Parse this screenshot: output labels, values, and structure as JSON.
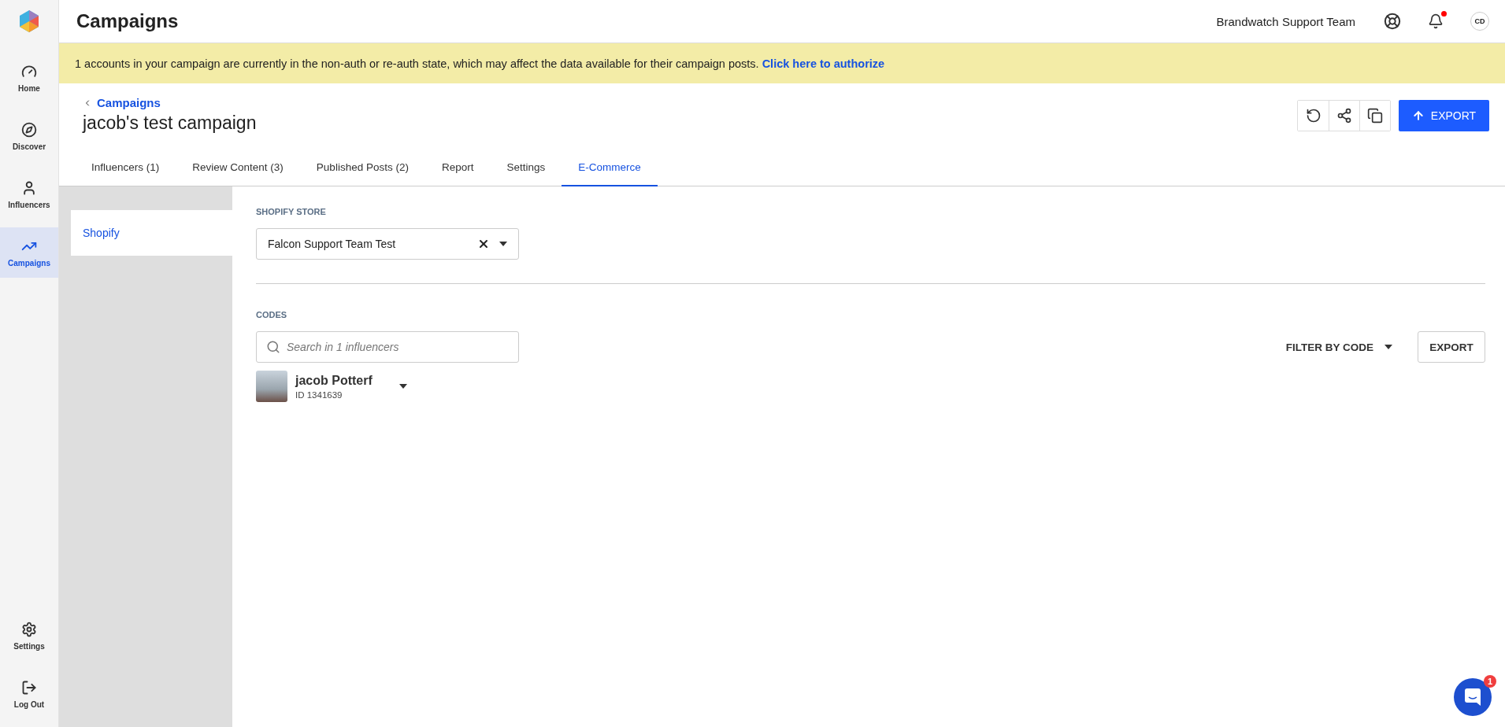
{
  "nav": {
    "items": [
      {
        "label": "Home",
        "selected": false
      },
      {
        "label": "Discover",
        "selected": false
      },
      {
        "label": "Influencers",
        "selected": false
      },
      {
        "label": "Campaigns",
        "selected": true
      }
    ],
    "bottom_items": [
      {
        "label": "Settings"
      },
      {
        "label": "Log Out"
      }
    ]
  },
  "topbar": {
    "title": "Campaigns",
    "team": "Brandwatch Support Team",
    "notifications_unread": true,
    "avatar_initials": "CD"
  },
  "banner": {
    "message": "1 accounts in your campaign are currently in the non-auth or re-auth state, which may affect the data available for their campaign posts.",
    "link": "Click here to authorize"
  },
  "header": {
    "breadcrumb": "Campaigns",
    "title": "jacob's test campaign",
    "export_label": "EXPORT"
  },
  "tabs": [
    {
      "label": "Influencers (1)",
      "selected": false
    },
    {
      "label": "Review Content (3)",
      "selected": false
    },
    {
      "label": "Published Posts (2)",
      "selected": false
    },
    {
      "label": "Report",
      "selected": false
    },
    {
      "label": "Settings",
      "selected": false
    },
    {
      "label": "E-Commerce",
      "selected": true
    }
  ],
  "subnav": [
    {
      "label": "Shopify",
      "selected": true
    }
  ],
  "store": {
    "label": "SHOPIFY STORE",
    "value": "Falcon Support Team Test"
  },
  "codes": {
    "label": "CODES",
    "search_placeholder": "Search in 1 influencers",
    "filter_label": "FILTER BY CODE",
    "export_label": "EXPORT",
    "influencers": [
      {
        "name": "jacob Potterf",
        "id": "ID 1341639"
      }
    ]
  },
  "chat": {
    "badge": "1"
  }
}
